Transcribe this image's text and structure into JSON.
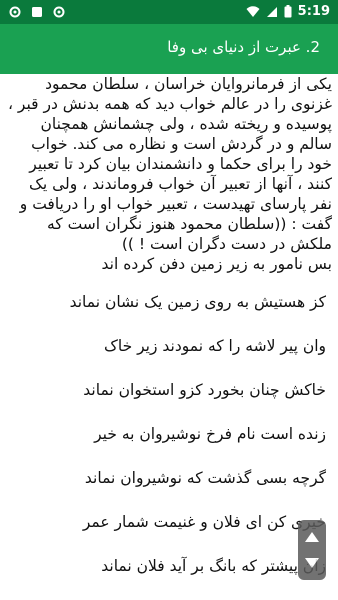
{
  "status_bar": {
    "time": "5:19",
    "left_icons": [
      "gear-icon",
      "square-icon",
      "gear-icon"
    ],
    "right_icons": [
      "wifi-icon",
      "signal-icon",
      "battery-icon"
    ]
  },
  "app_bar": {
    "title": "2. عبرت از دنیای بی وفا"
  },
  "content": {
    "paragraph": "یکی از فرمانروایان خراسان ، سلطان محمود غزنوی را در عالم خواب دید که همه بدنش در قبر ، پوسیده و ریخته شده ، ولی چشمانش همچنان سالم و در گردش است و نظاره می کند. خواب خود را برای حکما و دانشمندان بیان کرد تا تعبیر کنند ، آنها از تعبیر آن خواب فروماندند ، ولی یک نفر پارسای تهیدست ، تعبیر خواب او را دریافت و گفت : ((سلطان محمود هنوز نگران است که ملکش در دست دگران است ! ))",
    "paragraph2": "بس نامور به زیر زمین دفن کرده اند",
    "verses": [
      "کز هستیش به روی زمین یک نشان نماند",
      "وان پیر لاشه را که نمودند زیر خاک",
      "خاکش چنان بخورد کزو استخوان نماند",
      "زنده است نام فرخ نوشیروان به خیر",
      "گرچه بسی گذشت که نوشیروان نماند",
      "خیری کن ای فلان و غنیمت شمار عمر",
      "زان پیشتر که بانگ بر آید فلان نماند"
    ]
  },
  "colors": {
    "status_bar": "#0a7a3c",
    "app_bar": "#1aa152"
  },
  "overlay_icon": "scroll-handle-icon"
}
